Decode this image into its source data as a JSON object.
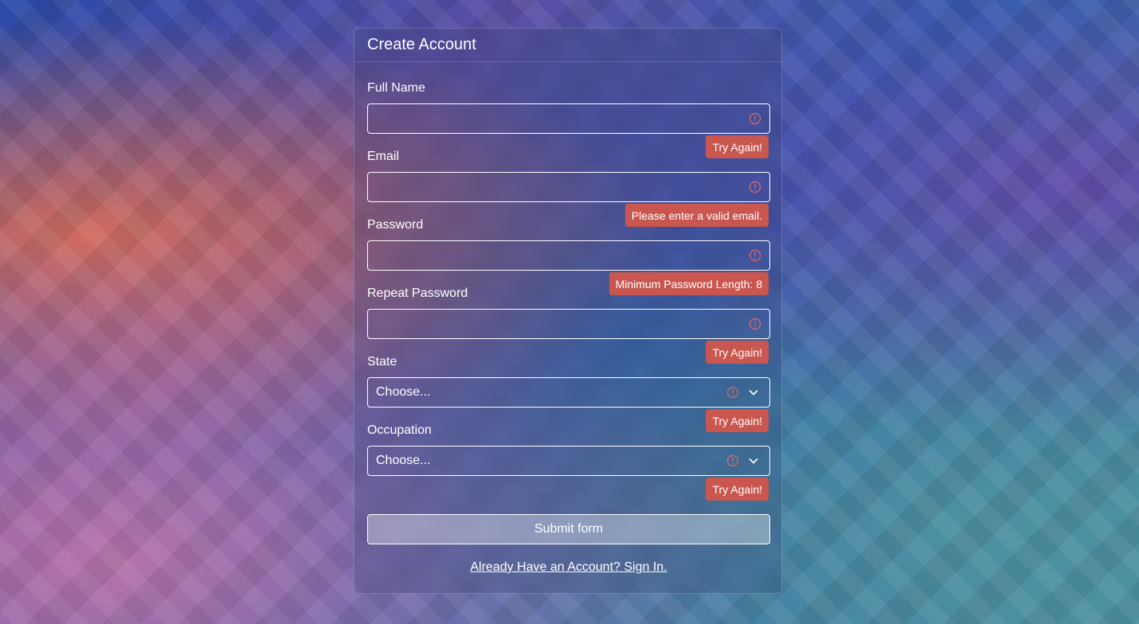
{
  "form": {
    "title": "Create Account",
    "fields": [
      {
        "label": "Full Name",
        "value": "",
        "error": "Try Again!"
      },
      {
        "label": "Email",
        "value": "",
        "error": "Please enter a valid email."
      },
      {
        "label": "Password",
        "value": "",
        "error": "Minimum Password Length: 8"
      },
      {
        "label": "Repeat Password",
        "value": "",
        "error": "Try Again!"
      },
      {
        "label": "State",
        "value": "Choose...",
        "error": "Try Again!"
      },
      {
        "label": "Occupation",
        "value": "Choose...",
        "error": "Try Again!"
      }
    ],
    "submit_label": "Submit form",
    "signin_link": "Already Have an Account? Sign In."
  },
  "icons": {
    "error": "exclamation-circle-icon",
    "dropdown": "chevron-down-icon"
  },
  "colors": {
    "error_badge": "#c9574f",
    "error_icon": "#e46a5f"
  }
}
